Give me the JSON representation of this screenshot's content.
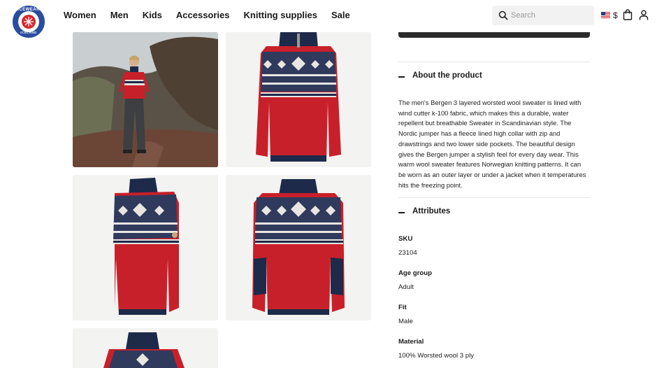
{
  "header": {
    "logo_text_top": "ICEWEAR",
    "logo_text_bottom": "ICELAND",
    "nav": [
      "Women",
      "Men",
      "Kids",
      "Accessories",
      "Knitting supplies",
      "Sale"
    ],
    "search_placeholder": "Search",
    "currency": "$",
    "icons": {
      "search": "search-icon",
      "flag": "us-flag-icon",
      "bag": "shopping-bag-icon",
      "account": "user-icon"
    }
  },
  "gallery": {
    "images": [
      "model-outdoors-photo",
      "sweater-front-photo",
      "sweater-side-photo",
      "sweater-back-photo",
      "sweater-detail-photo"
    ]
  },
  "product": {
    "about_title": "About the product",
    "description": "The men's Bergen 3 layered worsted wool sweater is lined with wind cutter k-100 fabric, which makes this a durable, water repellent but breathable Sweater in Scandinavian style. The Nordic jumper has a fleece lined high collar with zip and drawstrings and two lower side pockets. The beautiful design gives the Bergen jumper a stylish feel for every day wear. This warm wool sweater features Norwegian knitting patterns. It can be worn as an outer layer or under a jacket when it temperatures hits the freezing point.",
    "attributes_title": "Attributes",
    "attributes": [
      {
        "label": "SKU",
        "value": "23104"
      },
      {
        "label": "Age group",
        "value": "Adult"
      },
      {
        "label": "Fit",
        "value": "Male"
      },
      {
        "label": "Material",
        "value": "100% Worsted wool 3 ply"
      }
    ]
  },
  "colors": {
    "brand_blue": "#2b4da0",
    "brand_red": "#d9262d",
    "sweater_red": "#c8202a",
    "sweater_navy": "#1e2a4a",
    "cta_dark": "#2b2b2b"
  }
}
